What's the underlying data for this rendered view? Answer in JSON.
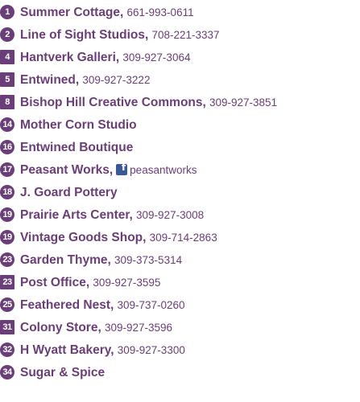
{
  "directory": [
    {
      "number": "1",
      "shape": "circle",
      "name": "Summer Cottage",
      "comma": ",",
      "phone": "661-993-0611"
    },
    {
      "number": "2",
      "shape": "circle",
      "name": "Line of Sight Studios",
      "comma": ",",
      "phone": "708-221-3337"
    },
    {
      "number": "4",
      "shape": "square",
      "name": "Hantverk Galleri",
      "comma": ",",
      "phone": "309-927-3064"
    },
    {
      "number": "5",
      "shape": "square",
      "name": "Entwined",
      "comma": ",",
      "phone": "309-927-3222"
    },
    {
      "number": "8",
      "shape": "square",
      "name": "Bishop Hill Creative Commons",
      "comma": ",",
      "phone": "309-927-3851"
    },
    {
      "number": "14",
      "shape": "circle",
      "name": "Mother Corn Studio"
    },
    {
      "number": "16",
      "shape": "circle",
      "name": "Entwined Boutique"
    },
    {
      "number": "17",
      "shape": "circle",
      "name": "Peasant Works",
      "comma": ",",
      "social_icon": "facebook-icon",
      "social": "peasantworks"
    },
    {
      "number": "18",
      "shape": "circle",
      "name": "J. Goard Pottery"
    },
    {
      "number": "19",
      "shape": "circle",
      "name": "Prairie Arts Center",
      "comma": ",",
      "phone": "309-927-3008"
    },
    {
      "number": "19",
      "shape": "circle",
      "name": "Vintage Goods Shop",
      "comma": ",",
      "phone": "309-714-2863"
    },
    {
      "number": "23",
      "shape": "circle",
      "name": "Garden Thyme",
      "comma": ",",
      "phone": "309-373-5314"
    },
    {
      "number": "23",
      "shape": "square",
      "name": "Post Office",
      "comma": ",",
      "phone": "309-927-3595"
    },
    {
      "number": "25",
      "shape": "circle",
      "name": "Feathered Nest",
      "comma": ",",
      "phone": "309-737-0260"
    },
    {
      "number": "31",
      "shape": "square",
      "name": "Colony Store",
      "comma": ",",
      "phone": "309-927-3596"
    },
    {
      "number": "32",
      "shape": "circle",
      "name": "H Wyatt Bakery",
      "comma": ",",
      "phone": "309-927-3300"
    },
    {
      "number": "34",
      "shape": "circle",
      "name": "Sugar & Spice"
    }
  ],
  "colors": {
    "accent": "#6a3e78",
    "marker_text": "#ffffff",
    "facebook": "#3b5998"
  }
}
